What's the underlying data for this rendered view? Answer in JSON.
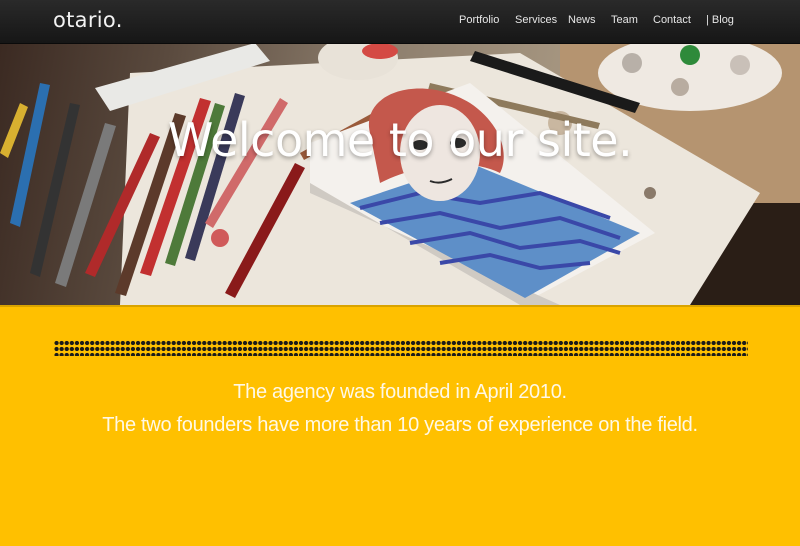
{
  "site": {
    "logo": "otario."
  },
  "nav": {
    "items": [
      {
        "label": "Portfolio"
      },
      {
        "label": "Services"
      },
      {
        "label": "News"
      },
      {
        "label": "Team"
      },
      {
        "label": "Contact"
      },
      {
        "label": "| Blog"
      }
    ]
  },
  "hero": {
    "title": "Welcome to our site."
  },
  "about": {
    "line1": "The agency was founded in April 2010.",
    "line2": "The two founders have more than 10 years of experience on the field."
  },
  "colors": {
    "accent": "#ffc000",
    "topbar": "#1e1e1e",
    "dots": "#1b1b1b"
  }
}
